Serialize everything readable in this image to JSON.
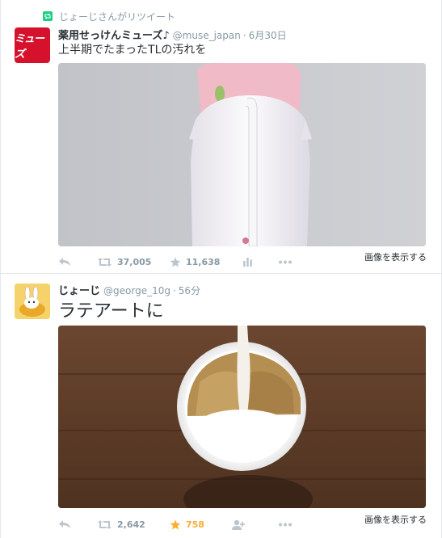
{
  "tweets": [
    {
      "retweet_context": "じょーじさんがリツイート",
      "avatar_text": "ミューズ",
      "name": "薬用せっけんミューズ♪",
      "handle": "@muse_japan",
      "separator": "·",
      "time": "6月30日",
      "text": "上半期でたまったTLの汚れを",
      "retweets": "37,005",
      "favorites": "11,638",
      "show_media": "画像を表示する"
    },
    {
      "name": "じょーじ",
      "handle": "@george_10g",
      "separator": "·",
      "time": "56分",
      "text": "ラテアートに",
      "retweets": "2,642",
      "favorites": "758",
      "show_media": "画像を表示する"
    }
  ],
  "colors": {
    "accent_favorite": "#ffac33",
    "muted": "#8899a6",
    "retweet_green": "#19cf86",
    "brand_muse": "#d6112b"
  },
  "icons": [
    "retweet-context-icon",
    "reply-icon",
    "retweet-icon",
    "favorite-icon",
    "analytics-icon",
    "follow-icon",
    "more-icon"
  ]
}
